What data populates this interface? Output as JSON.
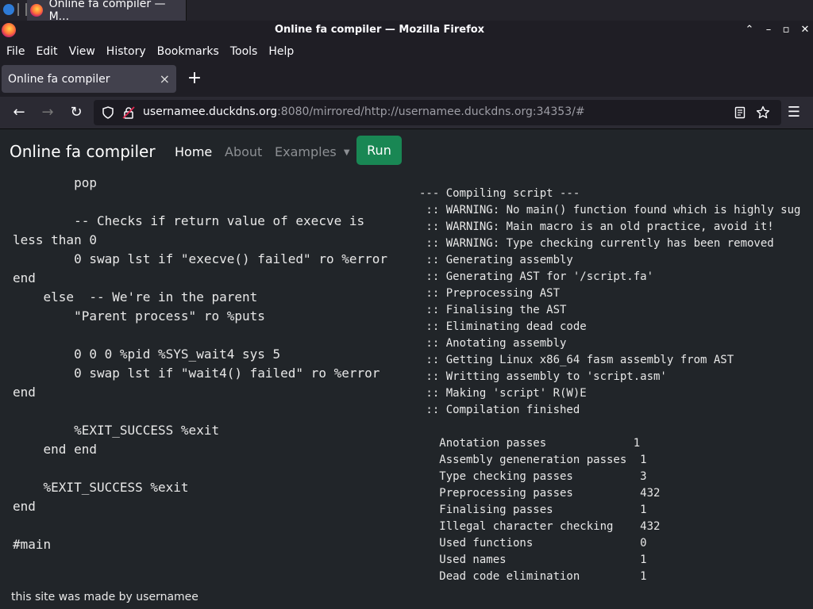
{
  "os_tab": {
    "title": "Online fa compiler — M..."
  },
  "window": {
    "title": "Online fa compiler — Mozilla Firefox"
  },
  "menu": [
    "File",
    "Edit",
    "View",
    "History",
    "Bookmarks",
    "Tools",
    "Help"
  ],
  "browser_tab": {
    "title": "Online fa compiler"
  },
  "url": {
    "host": "usernamee.duckdns.org",
    "rest": ":8080/mirrored/http://usernamee.duckdns.org:34353/#"
  },
  "site": {
    "brand": "Online fa compiler",
    "nav": {
      "home": "Home",
      "about": "About",
      "examples": "Examples"
    },
    "run": "Run",
    "footer": "this site was made by usernamee"
  },
  "code": "        pop\n\n        -- Checks if return value of execve is\nless than 0\n        0 swap lst if \"execve() failed\" ro %error\nend\n    else  -- We're in the parent\n        \"Parent process\" ro %puts\n\n        0 0 0 %pid %SYS_wait4 sys 5\n        0 swap lst if \"wait4() failed\" ro %error\nend\n\n        %EXIT_SUCCESS %exit\n    end end\n\n    %EXIT_SUCCESS %exit\nend\n\n#main",
  "output": "--- Compiling script ---\n :: WARNING: No main() function found which is highly sug\n :: WARNING: Main macro is an old practice, avoid it!\n :: WARNING: Type checking currently has been removed\n :: Generating assembly\n :: Generating AST for '/script.fa'\n :: Preprocessing AST\n :: Finalising the AST\n :: Eliminating dead code\n :: Anotating assembly\n :: Getting Linux x86_64 fasm assembly from AST\n :: Writting assembly to 'script.asm'\n :: Making 'script' R(W)E\n :: Compilation finished\n\n   Anotation passes             1\n   Assembly geneneration passes  1\n   Type checking passes          3\n   Preprocessing passes          432\n   Finalising passes             1\n   Illegal character checking    432\n   Used functions                0\n   Used names                    1\n   Dead code elimination         1"
}
